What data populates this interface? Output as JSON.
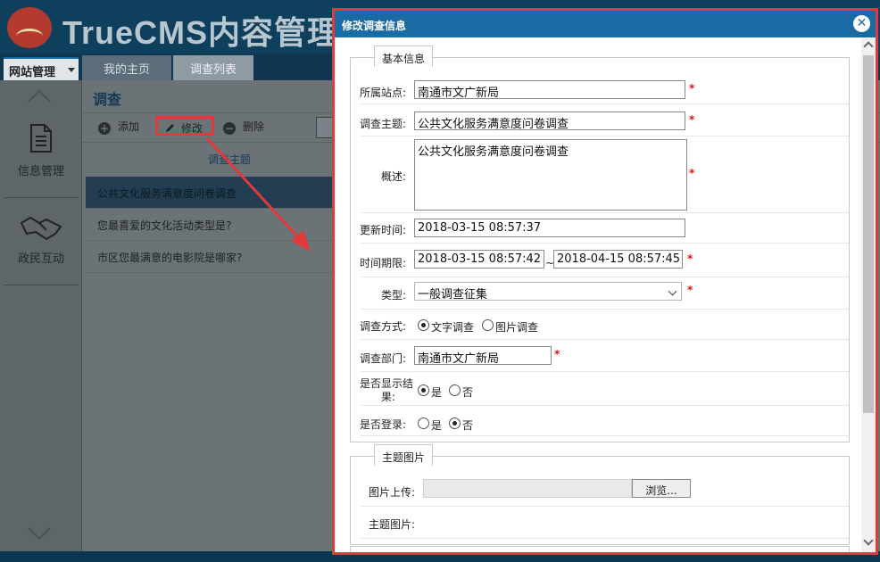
{
  "app": {
    "title": "TrueCMS内容管理系统",
    "nav": {
      "site_manage": "网站管理",
      "tabs": [
        "我的主页",
        "调查列表"
      ]
    },
    "sidebar": {
      "items": [
        {
          "label": "信息管理",
          "icon": "document-icon"
        },
        {
          "label": "政民互动",
          "icon": "handshake-icon"
        }
      ]
    },
    "content": {
      "title": "调查",
      "toolbar": {
        "add": "添加",
        "edit": "修改",
        "delete": "删除"
      },
      "column_header": "调查主题",
      "rows": [
        "公共文化服务满意度问卷调查",
        "您最喜爱的文化活动类型是?",
        "市区您最满意的电影院是哪家?"
      ]
    },
    "colors": {
      "accent": "#1a6ba3",
      "highlight": "#e23a3a",
      "required": "#e01010"
    }
  },
  "modal": {
    "title": "修改调查信息",
    "close": "✕",
    "basic": {
      "legend": "基本信息",
      "site": {
        "label": "所属站点:",
        "value": "南通市文广新局"
      },
      "topic": {
        "label": "调查主题:",
        "value": "公共文化服务满意度问卷调查"
      },
      "desc": {
        "label": "概述:",
        "value": "公共文化服务满意度问卷调查"
      },
      "updated": {
        "label": "更新时间:",
        "value": "2018-03-15 08:57:37"
      },
      "period": {
        "label": "时间期限:",
        "start": "2018-03-15 08:57:42",
        "sep": "~",
        "end": "2018-04-15 08:57:45"
      },
      "type": {
        "label": "类型:",
        "value": "一般调查征集"
      },
      "method": {
        "label": "调查方式:",
        "options": [
          "文字调查",
          "图片调查"
        ],
        "selected": "文字调查"
      },
      "dept": {
        "label": "调查部门:",
        "value": "南通市文广新局"
      },
      "show_result": {
        "label_line1": "是否显示结",
        "label_line2": "果:",
        "options": [
          "是",
          "否"
        ],
        "selected": "是"
      },
      "login": {
        "label": "是否登录:",
        "options": [
          "是",
          "否"
        ],
        "selected": "否"
      },
      "required_mark": "*"
    },
    "image": {
      "legend": "主题图片",
      "upload_label": "图片上传:",
      "browse": "浏览...",
      "image_label": "主题图片:"
    }
  }
}
